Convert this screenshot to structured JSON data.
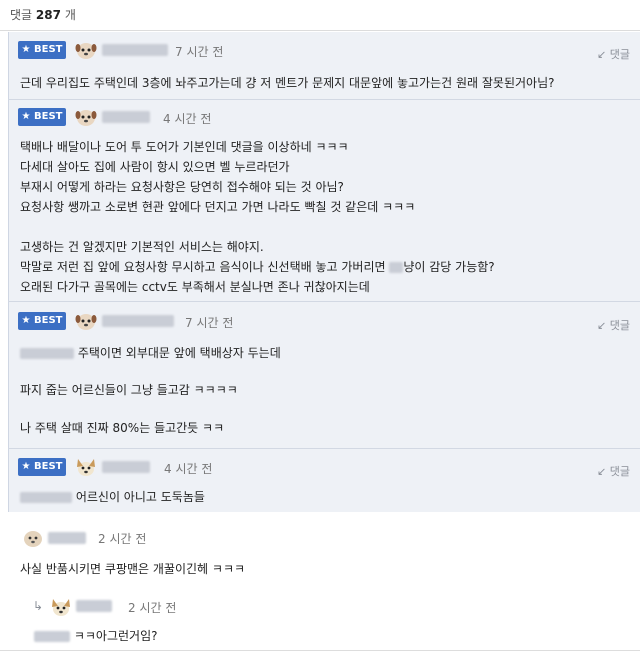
{
  "header": {
    "label": "댓글",
    "count": "287",
    "unit": "개"
  },
  "badge_label": "BEST",
  "reply_label": "댓글",
  "best_comments": [
    {
      "time": "7 시간 전",
      "lines": [
        "근데 우리집도 주택인데 3층에 놔주고가는데 걍 저 멘트가 문제지 대문앞에 놓고가는건 원래 잘못된거아님?"
      ]
    },
    {
      "time": "4 시간 전",
      "lines": [
        "택배나 배달이나 도어 투 도어가 기본인데 댓글을 이상하네 ㅋㅋㅋ",
        "다세대 살아도 집에 사람이 항시 있으면 벨 누르라던가",
        "부재시 어떻게 하라는 요청사항은 당연히 접수해야 되는 것 아님?",
        "요청사항 쌩까고 소로변 현관 앞에다 던지고 가면 나라도 빡칠 것 같은데 ㅋㅋㅋ",
        "",
        "고생하는 건 알겠지만 기본적인 서비스는 해야지.",
        "막말로 저런 집 앞에 요청사항 무시하고 음식이나 신선택배 놓고 가버리면",
        "오래된 다가구 골목에는 cctv도 부족해서 분실나면 존나 귀찮아지는데"
      ],
      "line7_tail": "냥이 감당 가능함?"
    },
    {
      "time": "7 시간 전",
      "lines": [
        "주택이면 외부대문 앞에 택배상자 두는데",
        "",
        "파지 줍는 어르신들이 그냥 들고감 ㅋㅋㅋㅋ",
        "",
        "나 주택 살때 진짜 80%는 들고간듯 ㅋㅋ"
      ]
    },
    {
      "time": "4 시간 전",
      "lines": [
        "어르신이 아니고 도둑놈들"
      ]
    }
  ],
  "normal_comments": [
    {
      "time": "2 시간 전",
      "text": "사실 반품시키면 쿠팡맨은 개꿀이긴헤 ㅋㅋㅋ"
    },
    {
      "time": "2 시간 전",
      "text": "ㅋㅋ아그런거임?",
      "is_reply": true
    }
  ],
  "icons": {
    "reply": "reply-arrow-icon",
    "star": "star-icon"
  },
  "colors": {
    "best_bg": "#eef1f6",
    "badge": "#3c6fc4"
  }
}
